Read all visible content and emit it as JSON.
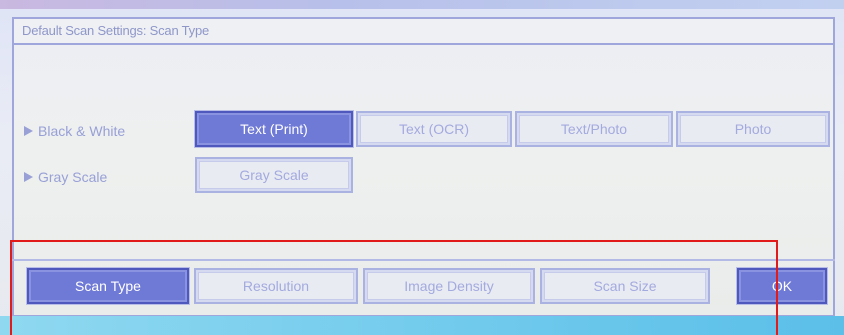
{
  "title": "Default Scan Settings: Scan Type",
  "rows": [
    {
      "label": "Black & White"
    },
    {
      "label": "Gray Scale"
    }
  ],
  "options": {
    "bw": [
      "Text (Print)",
      "Text (OCR)",
      "Text/Photo",
      "Photo"
    ],
    "gray": [
      "Gray Scale"
    ]
  },
  "selected_option": "Text (Print)",
  "tabs": [
    "Scan Type",
    "Resolution",
    "Image Density",
    "Scan Size"
  ],
  "selected_tab": "Scan Type",
  "ok_label": "OK",
  "colors": {
    "selected": "#6f79d6",
    "unselected_text": "#a3aade",
    "highlight_box": "#e11a1a"
  }
}
